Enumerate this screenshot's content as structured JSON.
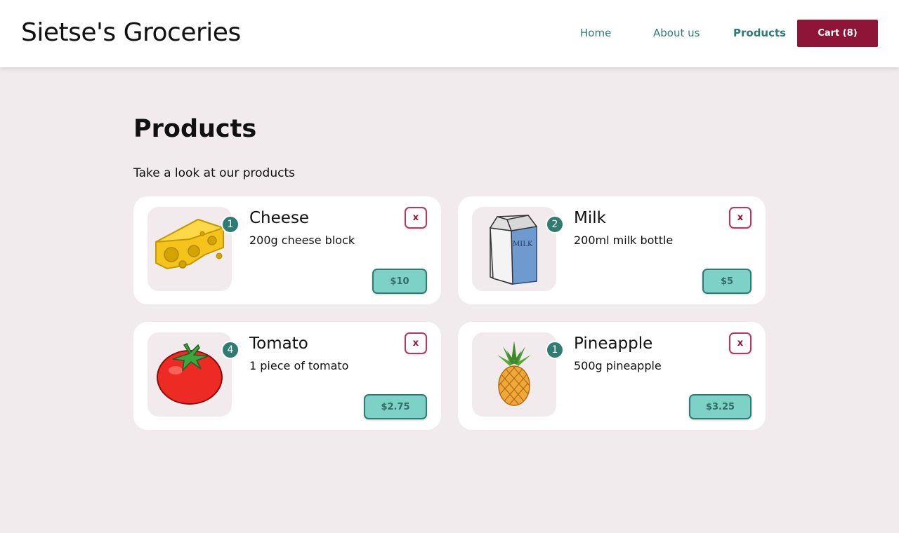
{
  "header": {
    "site_title": "Sietse's Groceries",
    "nav": [
      {
        "label": "Home"
      },
      {
        "label": "About us"
      },
      {
        "label": "Products"
      }
    ],
    "cart_label": "Cart (8)",
    "active_nav": "Products"
  },
  "main": {
    "heading": "Products",
    "subtitle": "Take a look at our products"
  },
  "products": [
    {
      "name": "Cheese",
      "description": "200g cheese block",
      "quantity": "1",
      "price": "$10",
      "remove_label": "x",
      "icon": "cheese-icon"
    },
    {
      "name": "Milk",
      "description": "200ml milk bottle",
      "quantity": "2",
      "price": "$5",
      "remove_label": "x",
      "icon": "milk-carton-icon",
      "carton_text": "MILK"
    },
    {
      "name": "Tomato",
      "description": "1 piece of tomato",
      "quantity": "4",
      "price": "$2.75",
      "remove_label": "x",
      "icon": "tomato-icon"
    },
    {
      "name": "Pineapple",
      "description": "500g pineapple",
      "quantity": "1",
      "price": "$3.25",
      "remove_label": "x",
      "icon": "pineapple-icon"
    }
  ],
  "colors": {
    "brand": "#8e1538",
    "accent": "#2f7c72",
    "price_bg": "#7dd1c6",
    "page_bg": "#f1ebee"
  }
}
